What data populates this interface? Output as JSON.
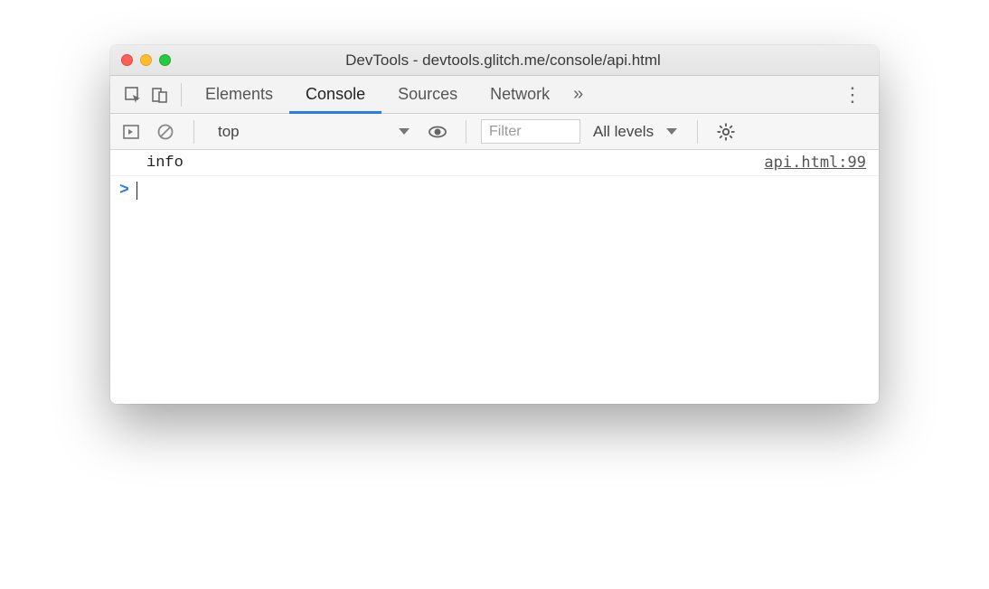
{
  "window": {
    "title": "DevTools - devtools.glitch.me/console/api.html"
  },
  "tabs": {
    "items": [
      {
        "label": "Elements",
        "active": false
      },
      {
        "label": "Console",
        "active": true
      },
      {
        "label": "Sources",
        "active": false
      },
      {
        "label": "Network",
        "active": false
      }
    ],
    "more": "»"
  },
  "filterbar": {
    "context": "top",
    "filter_placeholder": "Filter",
    "levels_label": "All levels"
  },
  "console": {
    "rows": [
      {
        "message": "info",
        "source": "api.html:99"
      }
    ],
    "prompt": ">"
  }
}
